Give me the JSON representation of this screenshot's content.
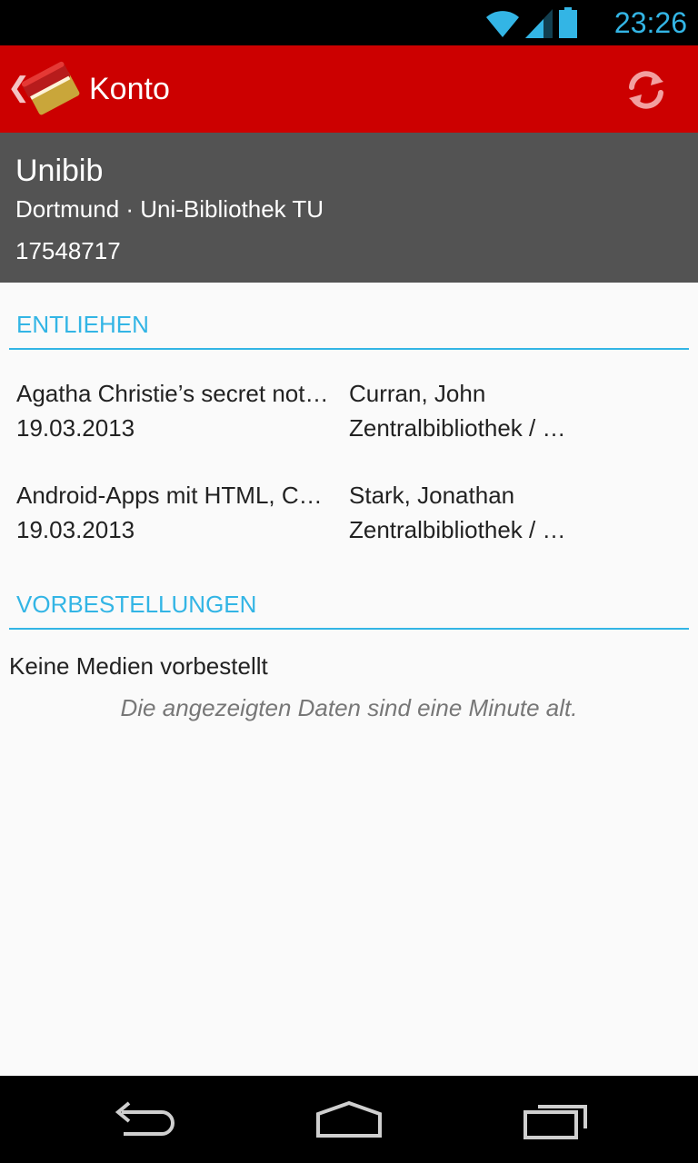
{
  "status_bar": {
    "time": "23:26",
    "icons": [
      "wifi-icon",
      "signal-icon",
      "battery-icon"
    ],
    "accent_color": "#33b5e5"
  },
  "action_bar": {
    "title": "Konto",
    "color": "#cc0000",
    "icons": [
      "up-caret-icon",
      "book-app-icon",
      "refresh-icon"
    ]
  },
  "account": {
    "name": "Unibib",
    "library": "Dortmund · Uni-Bibliothek TU",
    "number": "17548717"
  },
  "sections": {
    "lent": {
      "header": "ENTLIEHEN",
      "items": [
        {
          "title": "Agatha Christie’s secret not…",
          "author": "Curran, John",
          "date": "19.03.2013",
          "branch": "Zentralbibliothek / …"
        },
        {
          "title": "Android-Apps mit HTML, C…",
          "author": "Stark, Jonathan",
          "date": "19.03.2013",
          "branch": "Zentralbibliothek / …"
        }
      ]
    },
    "reservations": {
      "header": "VORBESTELLUNGEN",
      "empty_text": "Keine Medien vorbestellt"
    }
  },
  "data_age": "Die angezeigten Daten sind eine Minute alt.",
  "nav_bar": {
    "buttons": [
      "back-icon",
      "home-icon",
      "recent-apps-icon"
    ]
  }
}
